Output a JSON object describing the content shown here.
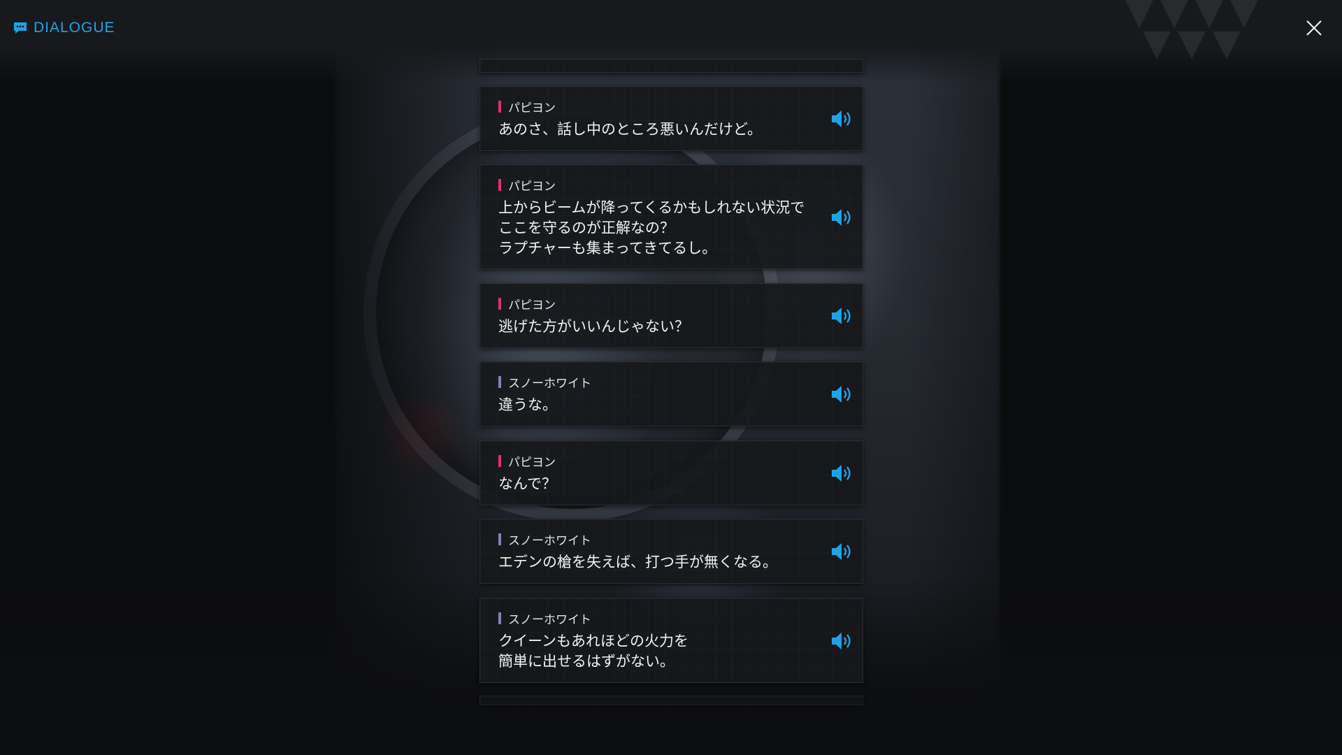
{
  "header": {
    "title": "DIALOGUE"
  },
  "colors": {
    "accent": "#1fa3e8",
    "papillon": "#e0306e",
    "snow_white": "#8a7fb8"
  },
  "dialogue": [
    {
      "speaker": "パピヨン",
      "speaker_key": "papillon",
      "text": "あのさ、話し中のところ悪いんだけど。"
    },
    {
      "speaker": "パピヨン",
      "speaker_key": "papillon",
      "text": "上からビームが降ってくるかもしれない状況で\nここを守るのが正解なの？\nラプチャーも集まってきてるし。"
    },
    {
      "speaker": "パピヨン",
      "speaker_key": "papillon",
      "text": "逃げた方がいいんじゃない？"
    },
    {
      "speaker": "スノーホワイト",
      "speaker_key": "snow_white",
      "text": "違うな。"
    },
    {
      "speaker": "パピヨン",
      "speaker_key": "papillon",
      "text": "なんで？"
    },
    {
      "speaker": "スノーホワイト",
      "speaker_key": "snow_white",
      "text": "エデンの槍を失えば、打つ手が無くなる。"
    },
    {
      "speaker": "スノーホワイト",
      "speaker_key": "snow_white",
      "text": "クイーンもあれほどの火力を\n簡単に出せるはずがない。"
    }
  ]
}
